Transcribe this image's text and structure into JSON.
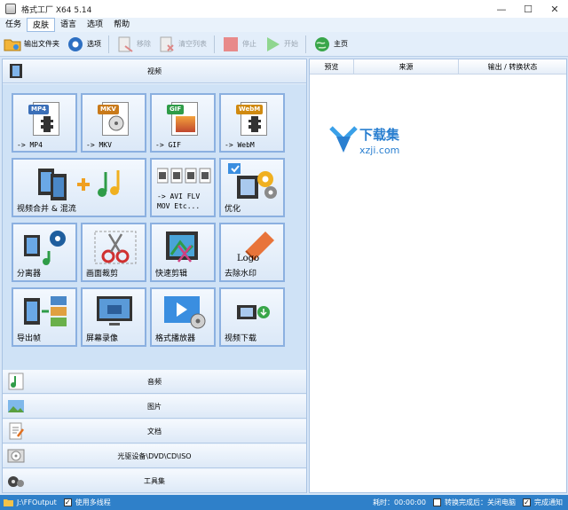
{
  "window": {
    "title": "格式工厂 X64 5.14",
    "minimize": "—",
    "maximize": "☐",
    "close": "✕"
  },
  "menu": [
    "任务",
    "皮肤",
    "语言",
    "选项",
    "帮助"
  ],
  "toolbar": {
    "output_folder": "输出文件夹",
    "options": "选项",
    "remove": "移除",
    "clear_list": "清空列表",
    "stop": "停止",
    "start": "开始",
    "home": "主页"
  },
  "categories": {
    "video": "视频",
    "audio": "音频",
    "image": "图片",
    "document": "文档",
    "optical": "光驱设备\\DVD\\CD\\ISO",
    "tools": "工具集"
  },
  "tiles": {
    "mp4": {
      "tag": "MP4",
      "label": "-> MP4"
    },
    "mkv": {
      "tag": "MKV",
      "label": "-> MKV"
    },
    "gif": {
      "tag": "GIF",
      "label": "-> GIF"
    },
    "webm": {
      "tag": "WebM",
      "label": "-> WebM"
    },
    "merge": {
      "label": "视频合并 & 混流"
    },
    "avi": {
      "line1": "-> AVI FLV",
      "line2": "MOV Etc..."
    },
    "optimize": {
      "label": "优化"
    },
    "splitter": {
      "label": "分离器"
    },
    "crop": {
      "label": "画面裁剪"
    },
    "quick_clip": {
      "label": "快速剪辑"
    },
    "remove_watermark": {
      "label": "去除水印",
      "logo_text": "Logo"
    },
    "export_frames": {
      "label": "导出帧"
    },
    "screen_record": {
      "label": "屏幕录像"
    },
    "player": {
      "label": "格式播放器"
    },
    "download": {
      "label": "视频下载"
    }
  },
  "task_table": {
    "columns": [
      "预览",
      "来源",
      "输出 / 转换状态"
    ]
  },
  "watermark": {
    "title": "下载集",
    "subtitle": "xzji.com"
  },
  "statusbar": {
    "output_path": "J:\\FFOutput",
    "multithread": "使用多线程",
    "elapsed": "耗时：00:00:00",
    "after_done": "转换完成后：关闭电脑",
    "notify": "完成通知"
  },
  "colors": {
    "accent": "#2f80c9",
    "tile_border": "#8bb0e0",
    "mp4": "#3b6fb8",
    "mkv": "#c97a1a",
    "gif": "#2f9c48",
    "webm": "#d08a10"
  }
}
